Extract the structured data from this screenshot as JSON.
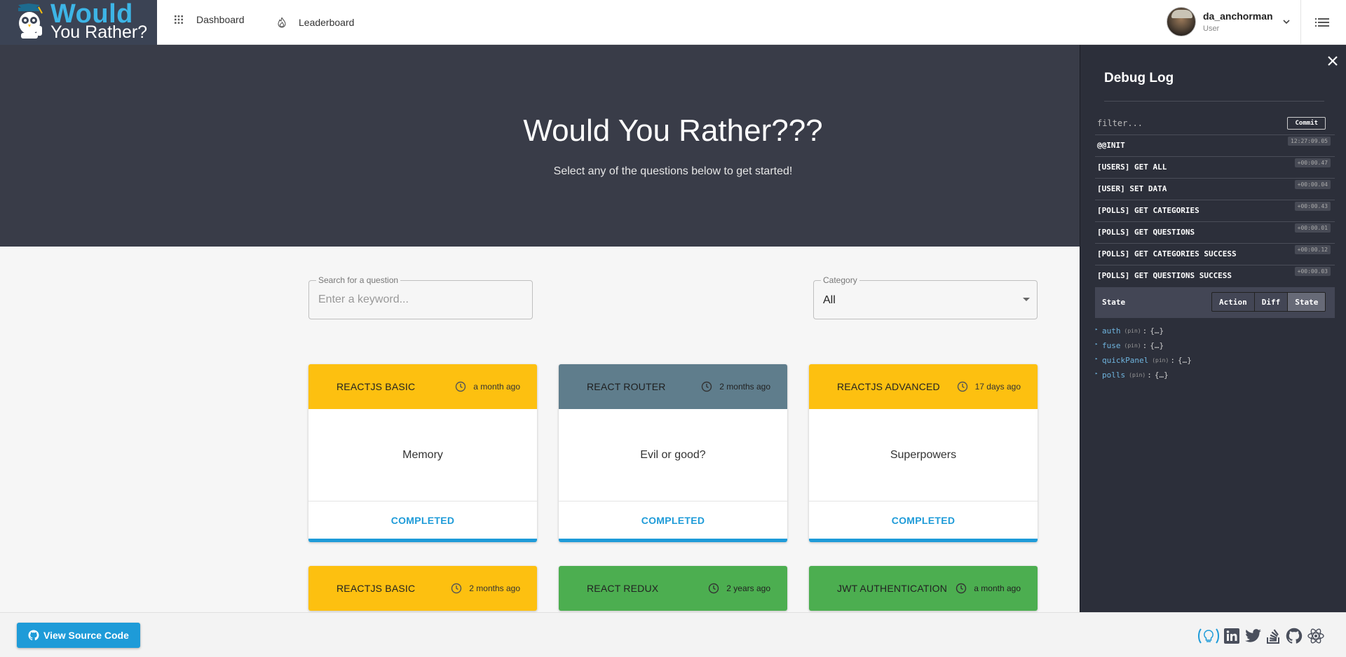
{
  "header": {
    "logo_line1": "Would",
    "logo_line2": "You Rather?",
    "nav": [
      {
        "label": "Dashboard",
        "icon": "apps-icon"
      },
      {
        "label": "Leaderboard",
        "icon": "whatshot-icon"
      }
    ],
    "user": {
      "name": "da_anchorman",
      "role": "User"
    }
  },
  "hero": {
    "title": "Would You Rather???",
    "subtitle": "Select any of the questions below to get started!"
  },
  "filters": {
    "search_label": "Search for a question",
    "search_placeholder": "Enter a keyword...",
    "search_value": "",
    "category_label": "Category",
    "category_value": "All"
  },
  "cards": [
    {
      "category": "REACTJS BASIC",
      "time": "a month ago",
      "question": "Memory",
      "status": "COMPLETED",
      "color": "#fdc010"
    },
    {
      "category": "REACT ROUTER",
      "time": "2 months ago",
      "question": "Evil or good?",
      "status": "COMPLETED",
      "color": "#5f7d8c"
    },
    {
      "category": "REACTJS ADVANCED",
      "time": "17 days ago",
      "question": "Superpowers",
      "status": "COMPLETED",
      "color": "#fdc010"
    },
    {
      "category": "REACTJS BASIC",
      "time": "2 months ago",
      "color": "#fdc010"
    },
    {
      "category": "REACT REDUX",
      "time": "2 years ago",
      "color": "#4cae50"
    },
    {
      "category": "JWT AUTHENTICATION",
      "time": "a month ago",
      "color": "#4cae50"
    }
  ],
  "footer": {
    "source_button": "View Source Code",
    "social_icons": [
      "lightbulb-icon",
      "linkedin-icon",
      "twitter-icon",
      "stackoverflow-icon",
      "github-icon",
      "react-icon"
    ]
  },
  "debug": {
    "title": "Debug Log",
    "filter_placeholder": "filter...",
    "commit_label": "Commit",
    "actions": [
      {
        "name": "@@INIT",
        "time": "12:27:09.05"
      },
      {
        "name": "[USERS] GET ALL",
        "time": "+00:00.47"
      },
      {
        "name": "[USER] SET DATA",
        "time": "+00:00.04"
      },
      {
        "name": "[POLLS] GET CATEGORIES",
        "time": "+00:00.43"
      },
      {
        "name": "[POLLS] GET QUESTIONS",
        "time": "+00:00.01"
      },
      {
        "name": "[POLLS] GET CATEGORIES SUCCESS",
        "time": "+00:00.12"
      },
      {
        "name": "[POLLS] GET QUESTIONS SUCCESS",
        "time": "+00:00.03"
      }
    ],
    "state_label": "State",
    "tabs": [
      "Action",
      "Diff",
      "State"
    ],
    "active_tab": "State",
    "tree": [
      {
        "key": "auth",
        "pin": "(pin)",
        "value": "{…}"
      },
      {
        "key": "fuse",
        "pin": "(pin)",
        "value": "{…}"
      },
      {
        "key": "quickPanel",
        "pin": "(pin)",
        "value": "{…}"
      },
      {
        "key": "polls",
        "pin": "(pin)",
        "value": "{…}"
      }
    ]
  }
}
